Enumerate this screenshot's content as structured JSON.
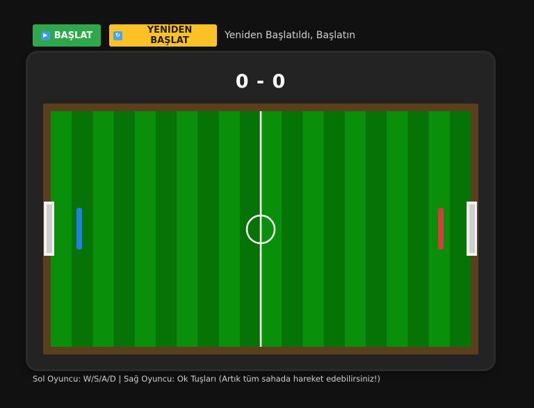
{
  "toolbar": {
    "start_label": "BAŞLAT",
    "start_icon": "play-icon",
    "restart_label": "YENİDEN BAŞLAT",
    "restart_icon": "refresh-icon",
    "status_message": "Yeniden Başlatıldı, Başlatın"
  },
  "scoreboard": {
    "left_score": "0",
    "separator": "-",
    "right_score": "0"
  },
  "field": {
    "stripe_count": 20,
    "colors": {
      "border": "#5b3e1d",
      "grass_light": "#0a8f0a",
      "grass_dark": "#067306",
      "lines": "#ffffff",
      "left_paddle": "#1f7fe6",
      "right_paddle": "#cf3f3c",
      "goal": "#f2f2f2"
    }
  },
  "players": {
    "left_color": "blue",
    "right_color": "red"
  },
  "footer": {
    "instructions": "Sol Oyuncu: W/S/A/D | Sağ Oyuncu: Ok Tuşları (Artık tüm sahada hareket edebilirsiniz!)"
  }
}
